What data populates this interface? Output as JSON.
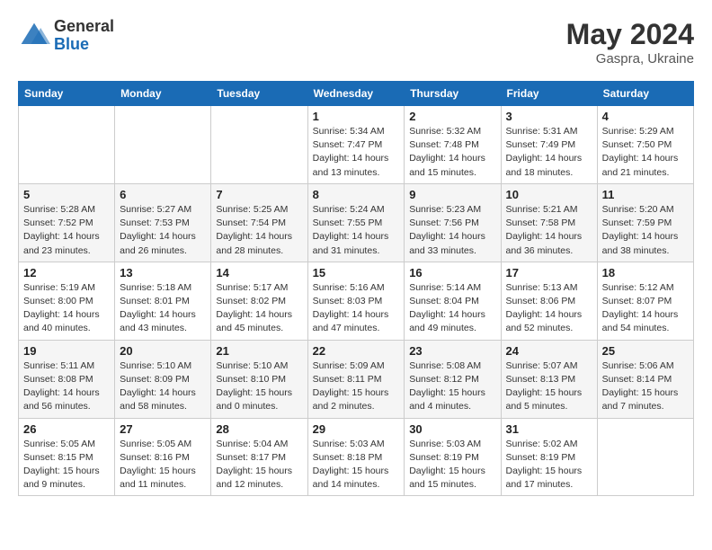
{
  "header": {
    "logo_general": "General",
    "logo_blue": "Blue",
    "month_year": "May 2024",
    "location": "Gaspra, Ukraine"
  },
  "weekdays": [
    "Sunday",
    "Monday",
    "Tuesday",
    "Wednesday",
    "Thursday",
    "Friday",
    "Saturday"
  ],
  "weeks": [
    [
      {
        "day": "",
        "info": ""
      },
      {
        "day": "",
        "info": ""
      },
      {
        "day": "",
        "info": ""
      },
      {
        "day": "1",
        "info": "Sunrise: 5:34 AM\nSunset: 7:47 PM\nDaylight: 14 hours\nand 13 minutes."
      },
      {
        "day": "2",
        "info": "Sunrise: 5:32 AM\nSunset: 7:48 PM\nDaylight: 14 hours\nand 15 minutes."
      },
      {
        "day": "3",
        "info": "Sunrise: 5:31 AM\nSunset: 7:49 PM\nDaylight: 14 hours\nand 18 minutes."
      },
      {
        "day": "4",
        "info": "Sunrise: 5:29 AM\nSunset: 7:50 PM\nDaylight: 14 hours\nand 21 minutes."
      }
    ],
    [
      {
        "day": "5",
        "info": "Sunrise: 5:28 AM\nSunset: 7:52 PM\nDaylight: 14 hours\nand 23 minutes."
      },
      {
        "day": "6",
        "info": "Sunrise: 5:27 AM\nSunset: 7:53 PM\nDaylight: 14 hours\nand 26 minutes."
      },
      {
        "day": "7",
        "info": "Sunrise: 5:25 AM\nSunset: 7:54 PM\nDaylight: 14 hours\nand 28 minutes."
      },
      {
        "day": "8",
        "info": "Sunrise: 5:24 AM\nSunset: 7:55 PM\nDaylight: 14 hours\nand 31 minutes."
      },
      {
        "day": "9",
        "info": "Sunrise: 5:23 AM\nSunset: 7:56 PM\nDaylight: 14 hours\nand 33 minutes."
      },
      {
        "day": "10",
        "info": "Sunrise: 5:21 AM\nSunset: 7:58 PM\nDaylight: 14 hours\nand 36 minutes."
      },
      {
        "day": "11",
        "info": "Sunrise: 5:20 AM\nSunset: 7:59 PM\nDaylight: 14 hours\nand 38 minutes."
      }
    ],
    [
      {
        "day": "12",
        "info": "Sunrise: 5:19 AM\nSunset: 8:00 PM\nDaylight: 14 hours\nand 40 minutes."
      },
      {
        "day": "13",
        "info": "Sunrise: 5:18 AM\nSunset: 8:01 PM\nDaylight: 14 hours\nand 43 minutes."
      },
      {
        "day": "14",
        "info": "Sunrise: 5:17 AM\nSunset: 8:02 PM\nDaylight: 14 hours\nand 45 minutes."
      },
      {
        "day": "15",
        "info": "Sunrise: 5:16 AM\nSunset: 8:03 PM\nDaylight: 14 hours\nand 47 minutes."
      },
      {
        "day": "16",
        "info": "Sunrise: 5:14 AM\nSunset: 8:04 PM\nDaylight: 14 hours\nand 49 minutes."
      },
      {
        "day": "17",
        "info": "Sunrise: 5:13 AM\nSunset: 8:06 PM\nDaylight: 14 hours\nand 52 minutes."
      },
      {
        "day": "18",
        "info": "Sunrise: 5:12 AM\nSunset: 8:07 PM\nDaylight: 14 hours\nand 54 minutes."
      }
    ],
    [
      {
        "day": "19",
        "info": "Sunrise: 5:11 AM\nSunset: 8:08 PM\nDaylight: 14 hours\nand 56 minutes."
      },
      {
        "day": "20",
        "info": "Sunrise: 5:10 AM\nSunset: 8:09 PM\nDaylight: 14 hours\nand 58 minutes."
      },
      {
        "day": "21",
        "info": "Sunrise: 5:10 AM\nSunset: 8:10 PM\nDaylight: 15 hours\nand 0 minutes."
      },
      {
        "day": "22",
        "info": "Sunrise: 5:09 AM\nSunset: 8:11 PM\nDaylight: 15 hours\nand 2 minutes."
      },
      {
        "day": "23",
        "info": "Sunrise: 5:08 AM\nSunset: 8:12 PM\nDaylight: 15 hours\nand 4 minutes."
      },
      {
        "day": "24",
        "info": "Sunrise: 5:07 AM\nSunset: 8:13 PM\nDaylight: 15 hours\nand 5 minutes."
      },
      {
        "day": "25",
        "info": "Sunrise: 5:06 AM\nSunset: 8:14 PM\nDaylight: 15 hours\nand 7 minutes."
      }
    ],
    [
      {
        "day": "26",
        "info": "Sunrise: 5:05 AM\nSunset: 8:15 PM\nDaylight: 15 hours\nand 9 minutes."
      },
      {
        "day": "27",
        "info": "Sunrise: 5:05 AM\nSunset: 8:16 PM\nDaylight: 15 hours\nand 11 minutes."
      },
      {
        "day": "28",
        "info": "Sunrise: 5:04 AM\nSunset: 8:17 PM\nDaylight: 15 hours\nand 12 minutes."
      },
      {
        "day": "29",
        "info": "Sunrise: 5:03 AM\nSunset: 8:18 PM\nDaylight: 15 hours\nand 14 minutes."
      },
      {
        "day": "30",
        "info": "Sunrise: 5:03 AM\nSunset: 8:19 PM\nDaylight: 15 hours\nand 15 minutes."
      },
      {
        "day": "31",
        "info": "Sunrise: 5:02 AM\nSunset: 8:19 PM\nDaylight: 15 hours\nand 17 minutes."
      },
      {
        "day": "",
        "info": ""
      }
    ]
  ]
}
